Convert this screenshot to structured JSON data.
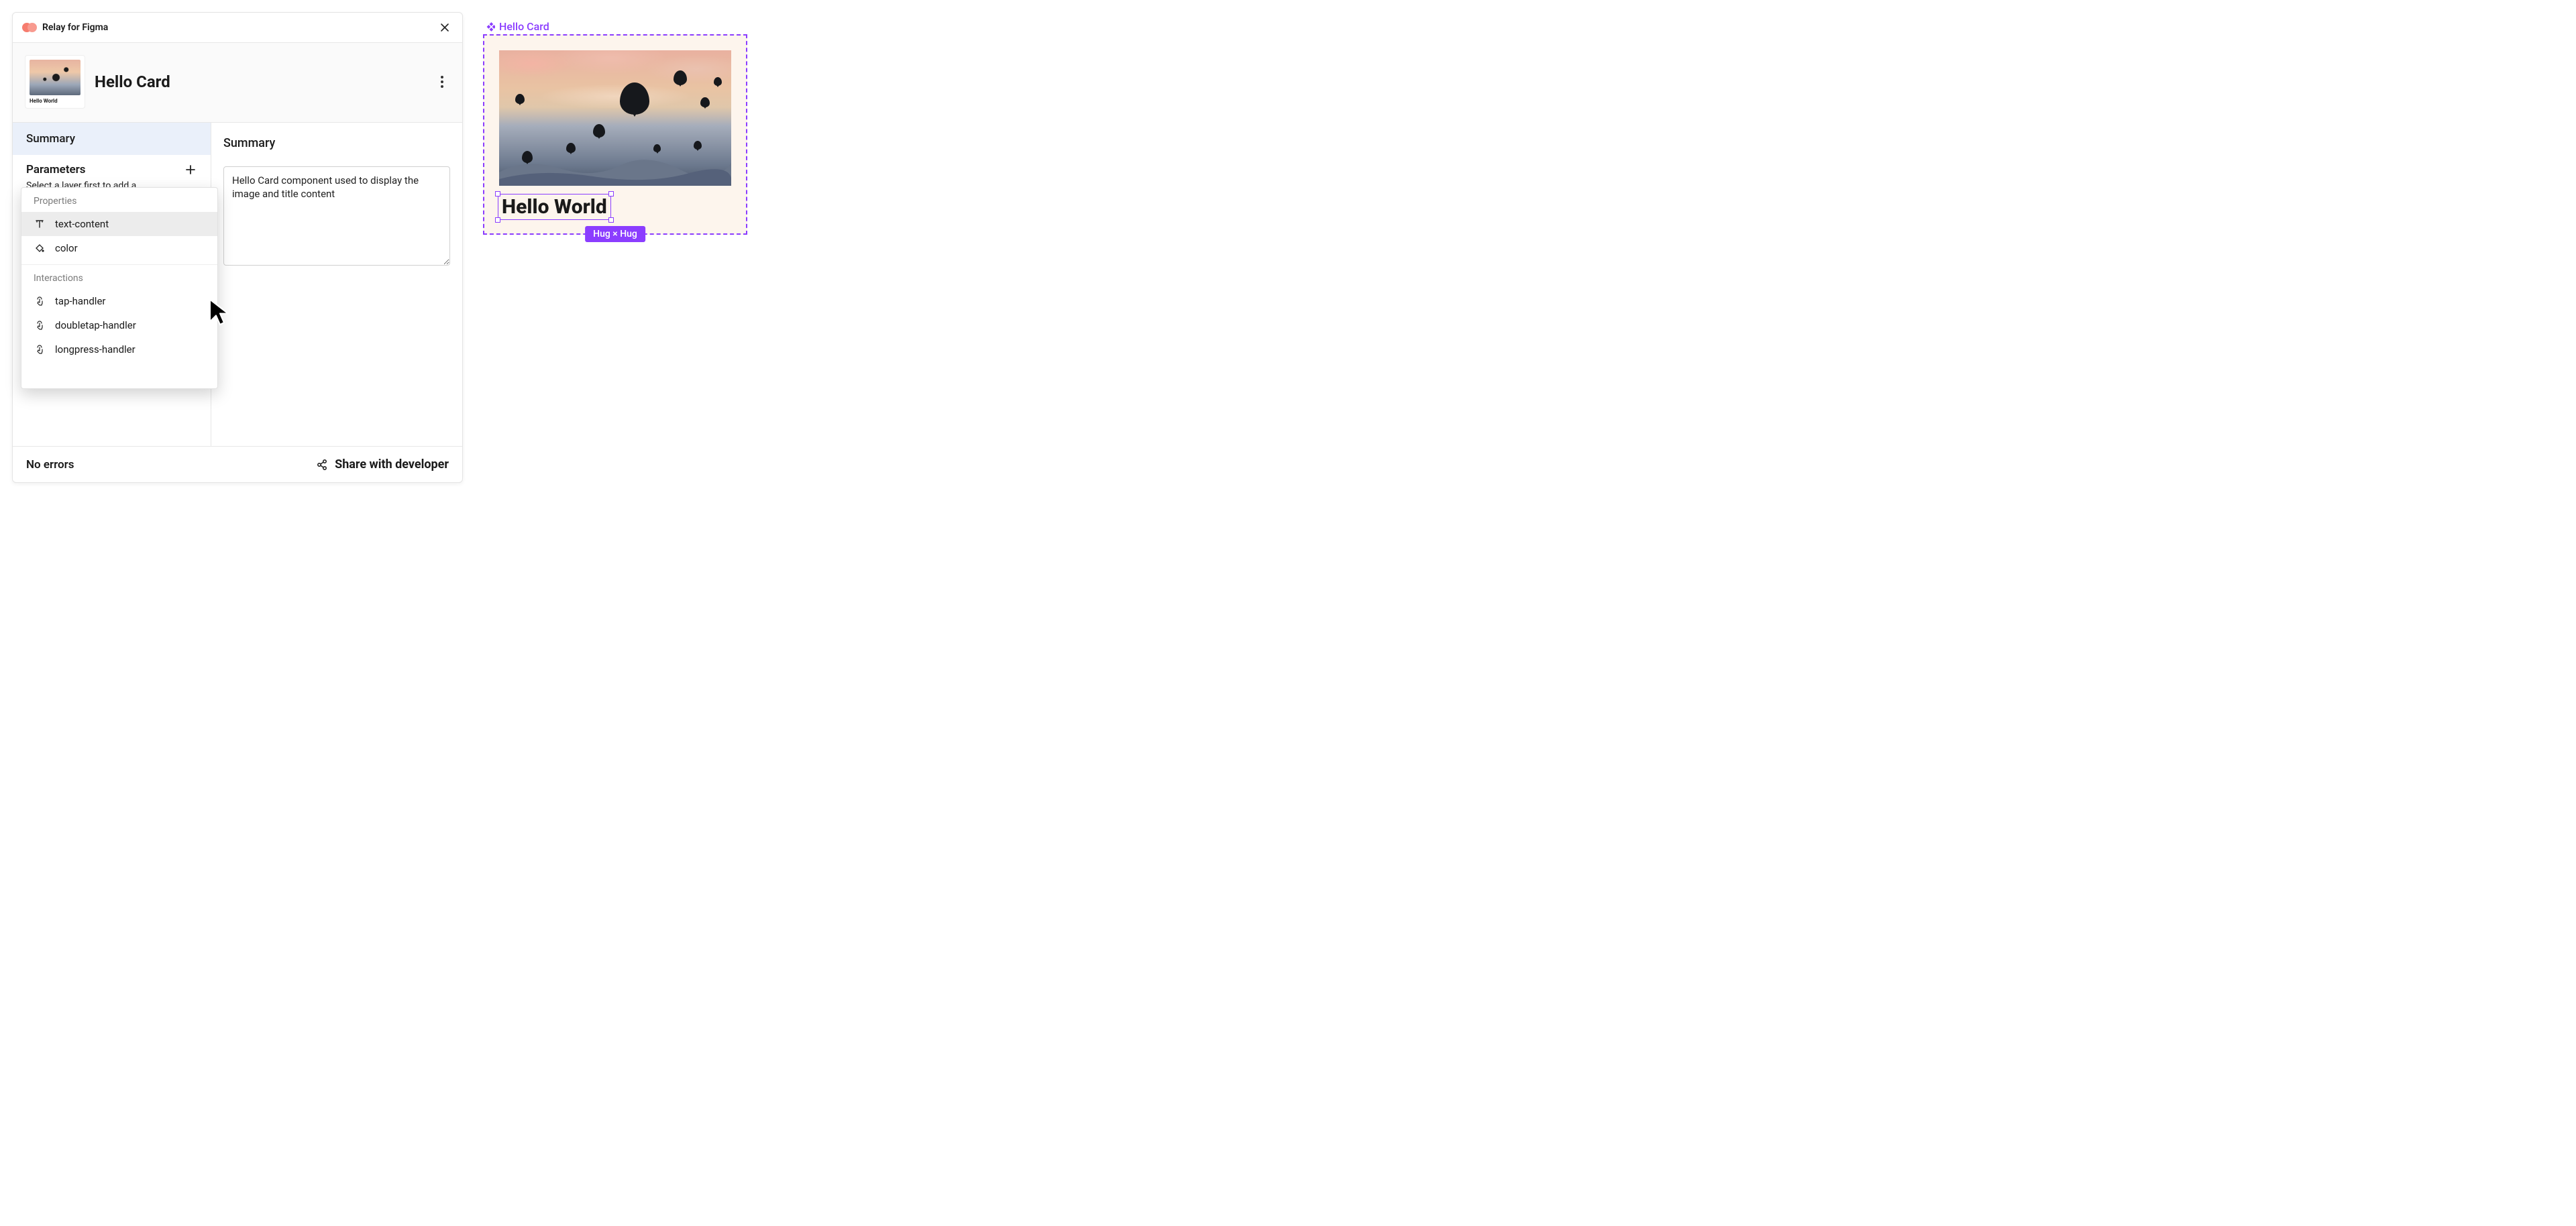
{
  "plugin": {
    "title": "Relay for Figma"
  },
  "header": {
    "component_name": "Hello Card",
    "thumb_caption": "Hello World"
  },
  "sidebar": {
    "items": [
      {
        "label": "Summary"
      }
    ],
    "parameters_title": "Parameters",
    "parameters_hint": "Select a layer first to add a"
  },
  "dropdown": {
    "groups": [
      {
        "label": "Properties",
        "items": [
          {
            "icon": "text",
            "label": "text-content",
            "hover": true
          },
          {
            "icon": "fill",
            "label": "color",
            "hover": false
          }
        ]
      },
      {
        "label": "Interactions",
        "items": [
          {
            "icon": "tap",
            "label": "tap-handler"
          },
          {
            "icon": "tap",
            "label": "doubletap-handler"
          },
          {
            "icon": "tap",
            "label": "longpress-handler"
          }
        ]
      }
    ]
  },
  "content": {
    "title": "Summary",
    "summary_text": "Hello Card component used to display the image and title content"
  },
  "footer": {
    "status": "No errors",
    "share_label": "Share with developer"
  },
  "canvas": {
    "component_label": "Hello Card",
    "text_node": "Hello World",
    "size_pill": "Hug × Hug"
  }
}
